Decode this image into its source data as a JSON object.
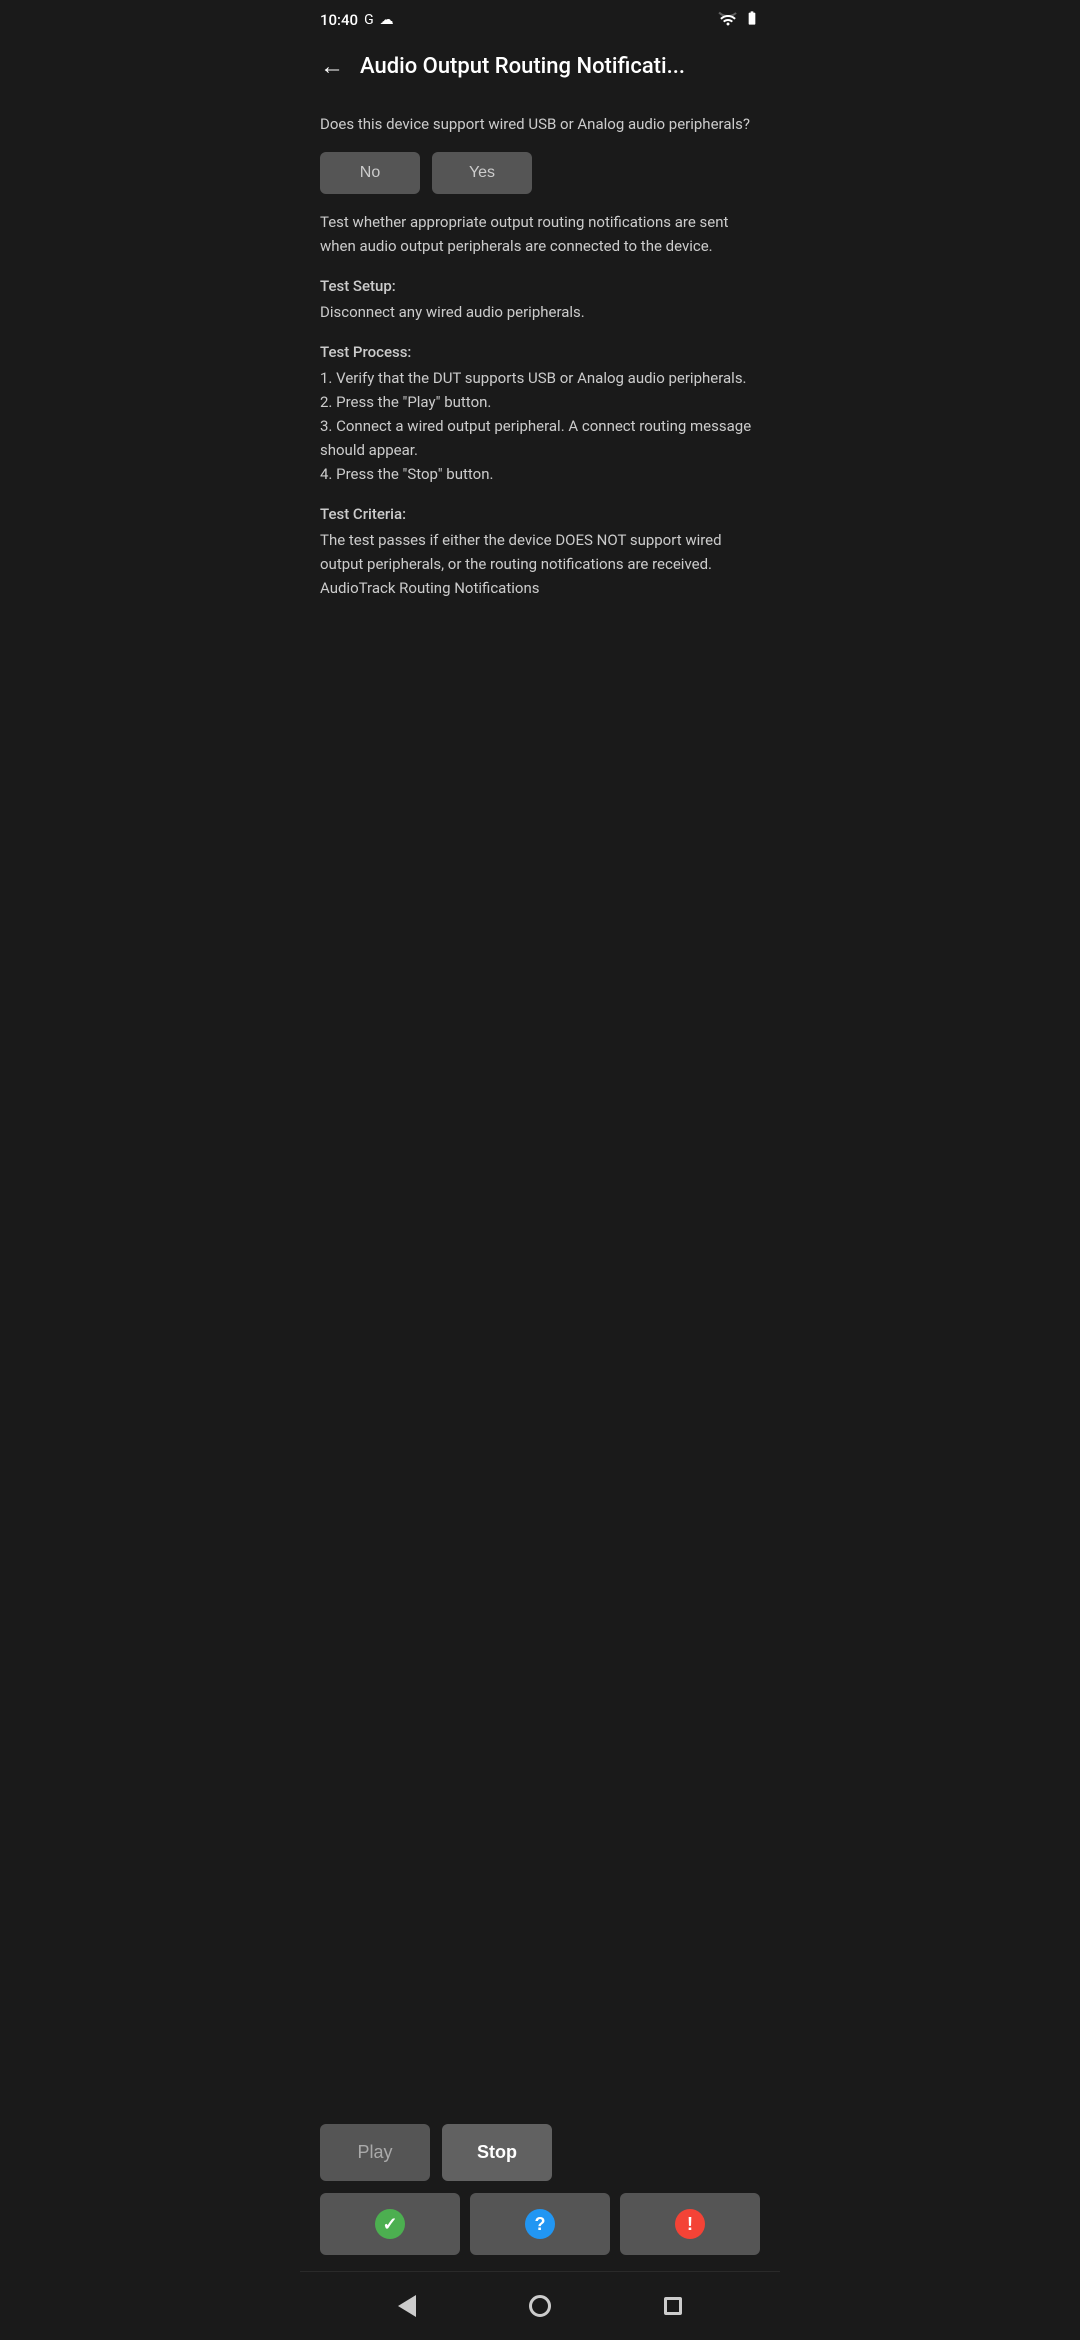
{
  "statusBar": {
    "time": "10:40",
    "googleIcon": "G",
    "cloudIcon": "☁"
  },
  "header": {
    "backLabel": "←",
    "title": "Audio Output Routing Notificati..."
  },
  "main": {
    "question": "Does this device support wired USB or Analog audio peripherals?",
    "noLabel": "No",
    "yesLabel": "Yes",
    "description": "Test whether appropriate output routing notifications are sent when audio output peripherals are connected to the device.",
    "testSetup": {
      "title": "Test Setup:",
      "body": "Disconnect any wired audio peripherals."
    },
    "testProcess": {
      "title": "Test Process:",
      "steps": [
        "1. Verify that the DUT supports USB or Analog audio peripherals.",
        "2. Press the \"Play\" button.",
        "3. Connect a wired output peripheral. A connect routing message should appear.",
        "4. Press the \"Stop\" button."
      ]
    },
    "testCriteria": {
      "title": "Test Criteria:",
      "body": "The test passes if either the device DOES NOT support wired output peripherals, or the routing notifications are received.",
      "footer": "AudioTrack Routing Notifications"
    }
  },
  "actions": {
    "playLabel": "Play",
    "stopLabel": "Stop"
  },
  "results": {
    "passIcon": "✓",
    "infoIcon": "?",
    "failIcon": "!"
  },
  "navBar": {
    "backTitle": "back",
    "homeTitle": "home",
    "recentTitle": "recent"
  }
}
